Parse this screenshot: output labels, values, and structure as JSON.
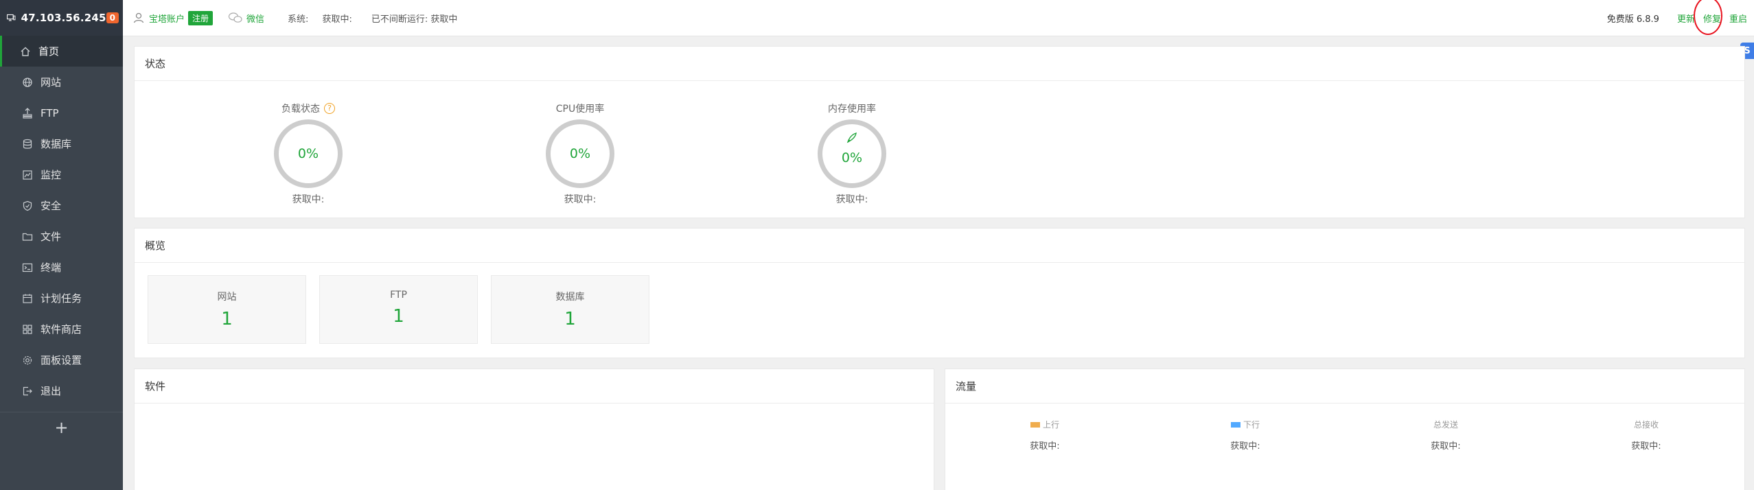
{
  "sidebar": {
    "ip": "47.103.56.245",
    "badge": "0",
    "items": [
      {
        "label": "首页",
        "icon": "home-icon",
        "active": true
      },
      {
        "label": "网站",
        "icon": "globe-icon"
      },
      {
        "label": "FTP",
        "icon": "ftp-icon"
      },
      {
        "label": "数据库",
        "icon": "database-icon"
      },
      {
        "label": "监控",
        "icon": "monitor-chart-icon"
      },
      {
        "label": "安全",
        "icon": "shield-icon"
      },
      {
        "label": "文件",
        "icon": "folder-icon"
      },
      {
        "label": "终端",
        "icon": "terminal-icon"
      },
      {
        "label": "计划任务",
        "icon": "calendar-icon"
      },
      {
        "label": "软件商店",
        "icon": "apps-icon"
      },
      {
        "label": "面板设置",
        "icon": "gear-icon"
      },
      {
        "label": "退出",
        "icon": "logout-icon"
      }
    ],
    "add": "+"
  },
  "topbar": {
    "account": "宝塔账户",
    "register": "注册",
    "wechat": "微信",
    "system_label": "系统:",
    "system_value": "获取中:",
    "uptime": "已不间断运行: 获取中",
    "version": "免费版 6.8.9",
    "update": "更新",
    "repair": "修复",
    "restart": "重启"
  },
  "status": {
    "title": "状态",
    "load": {
      "label": "负载状态",
      "value": "0%",
      "sub": "获取中:",
      "help": "?"
    },
    "cpu": {
      "label": "CPU使用率",
      "value": "0%",
      "sub": "获取中:"
    },
    "memory": {
      "label": "内存使用率",
      "value": "0%",
      "sub": "获取中:"
    }
  },
  "overview": {
    "title": "概览",
    "cards": [
      {
        "label": "网站",
        "value": "1"
      },
      {
        "label": "FTP",
        "value": "1"
      },
      {
        "label": "数据库",
        "value": "1"
      }
    ]
  },
  "software": {
    "title": "软件"
  },
  "traffic": {
    "title": "流量",
    "columns": [
      {
        "label": "上行",
        "value": "获取中:",
        "color": "#f0ad4e"
      },
      {
        "label": "下行",
        "value": "获取中:",
        "color": "#52a9ff"
      },
      {
        "label": "总发送",
        "value": "获取中:"
      },
      {
        "label": "总接收",
        "value": "获取中:"
      }
    ]
  },
  "colors": {
    "accent": "#20a53a",
    "sidebar": "#3c444d",
    "highlight": "#e8111d"
  }
}
